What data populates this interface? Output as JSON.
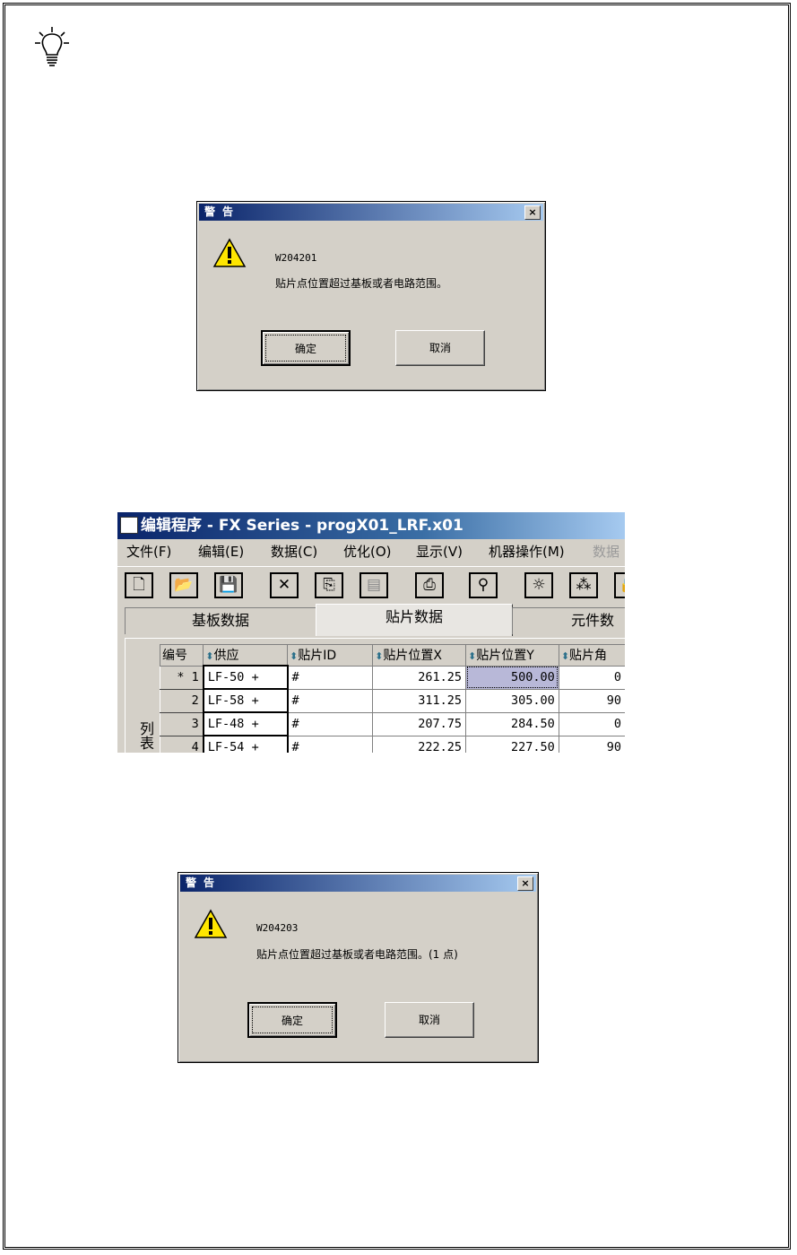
{
  "dialog1": {
    "title": "警告",
    "close": "×",
    "code": "W204201",
    "message": "贴片点位置超过基板或者电路范围。",
    "ok_label": "确定",
    "cancel_label": "取消"
  },
  "app": {
    "title": "编辑程序 - FX Series - progX01_LRF.x01",
    "menu": [
      "文件(F)",
      "编辑(E)",
      "数据(C)",
      "优化(O)",
      "显示(V)",
      "机器操作(M)",
      "数据"
    ],
    "tabs": [
      "基板数据",
      "贴片数据",
      "元件数"
    ],
    "side_label": "列表",
    "columns": [
      "编号",
      "供应",
      "贴片ID",
      "贴片位置X",
      "贴片位置Y",
      "贴片角"
    ],
    "rows": [
      {
        "num": "* 1",
        "supply": "LF-50 +",
        "id": "#",
        "x": "261.25",
        "y": "500.00",
        "angle": "0"
      },
      {
        "num": "2",
        "supply": "LF-58 +",
        "id": "#",
        "x": "311.25",
        "y": "305.00",
        "angle": "90"
      },
      {
        "num": "3",
        "supply": "LF-48 +",
        "id": "#",
        "x": "207.75",
        "y": "284.50",
        "angle": "0"
      },
      {
        "num": "4",
        "supply": "LF-54 +",
        "id": "#",
        "x": "222.25",
        "y": "227.50",
        "angle": "90"
      }
    ]
  },
  "dialog2": {
    "title": "警告",
    "close": "×",
    "code": "W204203",
    "message": "贴片点位置超过基板或者电路范围。(1 点)",
    "ok_label": "确定",
    "cancel_label": "取消"
  }
}
